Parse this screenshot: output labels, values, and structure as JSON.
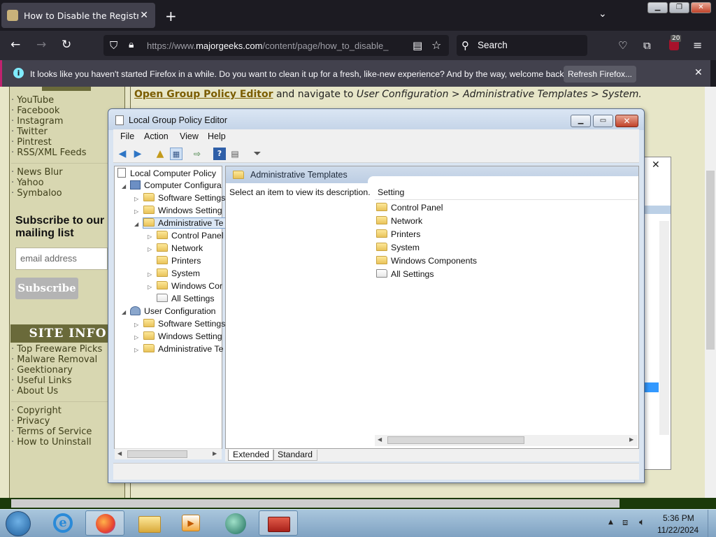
{
  "browser": {
    "tab_title": "How to Disable the Registry Edit",
    "url_prefix": "https://www.",
    "url_domain": "majorgeeks.com",
    "url_path": "/content/page/how_to_disable_",
    "search_placeholder": "Search",
    "extension_badge": "20",
    "notification_text": "It looks like you haven't started Firefox in a while. Do you want to clean it up for a fresh, like-new experience? And by the way, welcome back!",
    "refresh_button": "Refresh Firefox..."
  },
  "sidebar": {
    "social_links": [
      "YouTube",
      "Facebook",
      "Instagram",
      "Twitter",
      "Pintrest",
      "RSS/XML Feeds"
    ],
    "news_links": [
      "News Blur",
      "Yahoo",
      "Symbaloo"
    ],
    "subscribe_title": "Subscribe to our mailing list",
    "email_placeholder": "email address",
    "subscribe_button": "Subscribe",
    "site_info_header": "SITE INFO",
    "site_links": [
      "Top Freeware Picks",
      "Malware Removal",
      "Geektionary",
      "Useful Links",
      "About Us"
    ],
    "legal_links": [
      "Copyright",
      "Privacy",
      "Terms of Service",
      "How to Uninstall"
    ]
  },
  "content": {
    "link_text": "Open Group Policy Editor",
    "mid_text": " and navigate to ",
    "path_text": "User Configuration > Administrative Templates > System."
  },
  "gpedit": {
    "title": "Local Group Policy Editor",
    "menu": [
      "File",
      "Action",
      "View",
      "Help"
    ],
    "tree": {
      "root": "Local Computer Policy",
      "computer": "Computer Configura",
      "comp_children": [
        "Software Settings",
        "Windows Setting",
        "Administrative Te"
      ],
      "admin_children": [
        "Control Panel",
        "Network",
        "Printers",
        "System",
        "Windows Cor",
        "All Settings"
      ],
      "user": "User Configuration",
      "user_children": [
        "Software Settings",
        "Windows Setting",
        "Administrative Te"
      ]
    },
    "pane_header": "Administrative Templates",
    "description": "Select an item to view its description.",
    "column_header": "Setting",
    "items": [
      "Control Panel",
      "Network",
      "Printers",
      "System",
      "Windows Components",
      "All Settings"
    ],
    "tabs": [
      "Extended",
      "Standard"
    ]
  },
  "taskbar": {
    "time": "5:36 PM",
    "date": "11/22/2024"
  }
}
